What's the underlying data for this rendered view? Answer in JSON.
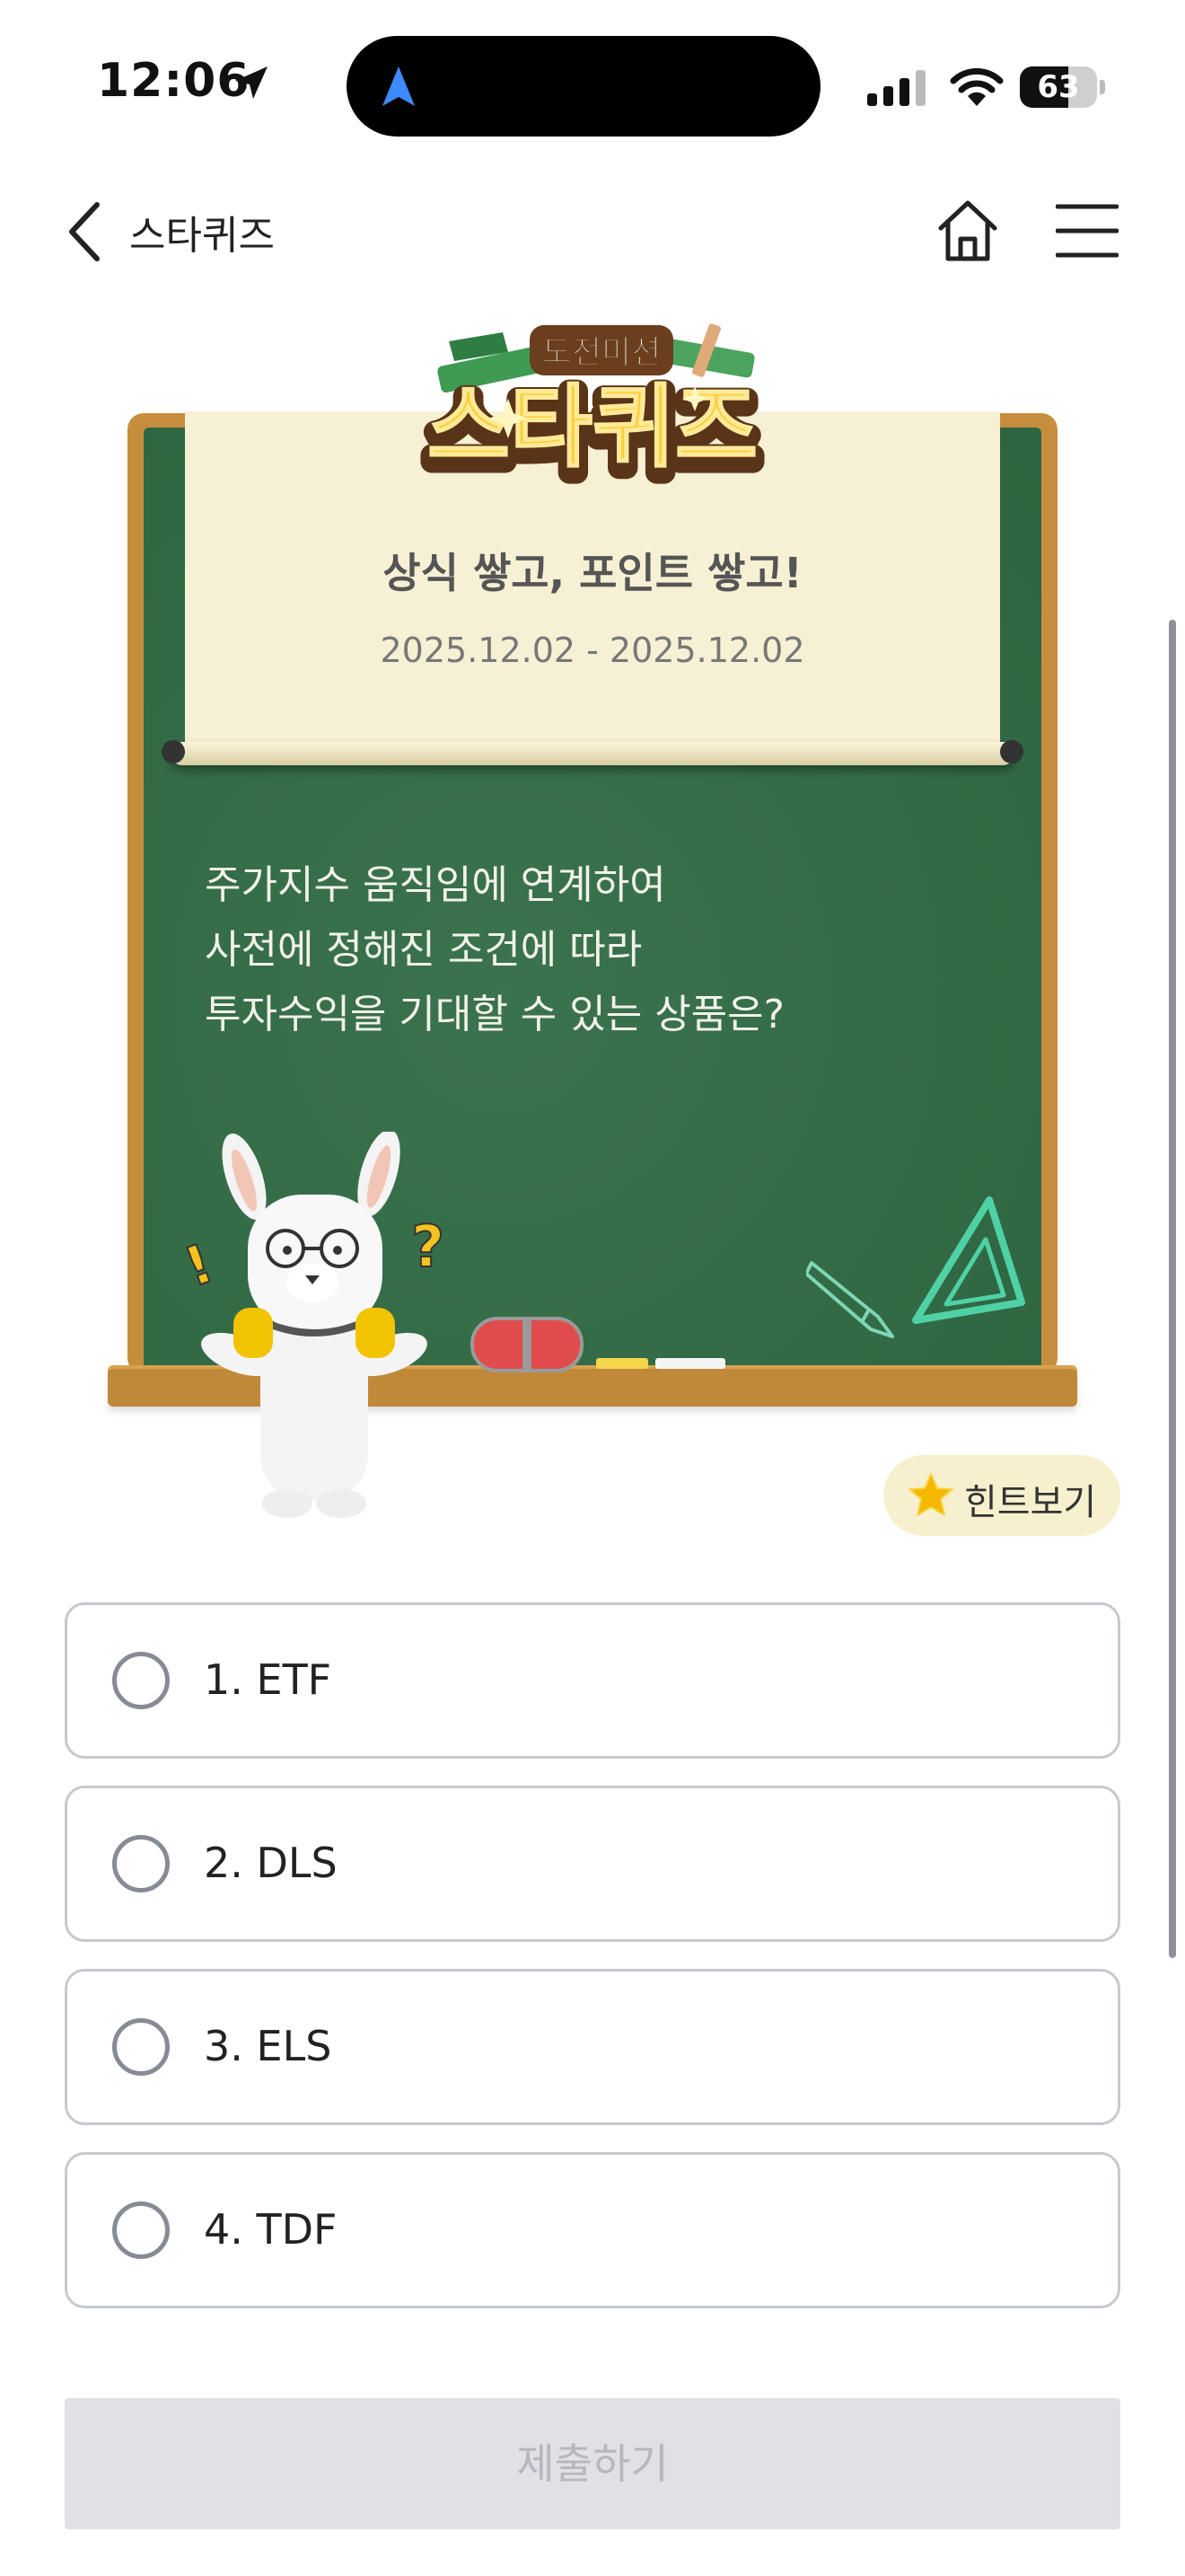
{
  "status_bar": {
    "time": "12:06",
    "battery": "63",
    "battery_level": 0.63
  },
  "header": {
    "title": "스타퀴즈"
  },
  "board": {
    "logo_small": "도전미션",
    "logo_big": "스타퀴즈",
    "subtitle": "상식 쌓고, 포인트 쌓고!",
    "date_range": "2025.12.02 - 2025.12.02",
    "question_lines": [
      "주가지수 움직임에 연계하여",
      "사전에 정해진 조건에 따라",
      "투자수익을 기대할 수 있는 상품은?"
    ]
  },
  "hint": {
    "label": "힌트보기"
  },
  "options": [
    {
      "label": "1. ETF"
    },
    {
      "label": "2. DLS"
    },
    {
      "label": "3. ELS"
    },
    {
      "label": "4. TDF"
    }
  ],
  "submit": {
    "label": "제출하기"
  },
  "colors": {
    "board": "#2f6a43",
    "frame": "#c68e3c",
    "paper": "#f6f0d4",
    "hint_bg": "#f7f0cf",
    "submit_bg": "#dfe1e5"
  }
}
